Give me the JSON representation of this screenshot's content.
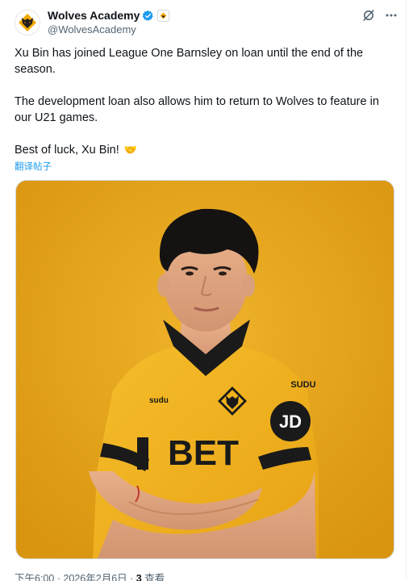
{
  "account": {
    "display_name": "Wolves Academy",
    "handle": "@WolvesAcademy",
    "avatar_icon": "wolf-head-icon",
    "verified_icon": "verified-badge-icon",
    "affiliate_icon": "club-affiliate-icon"
  },
  "actions": {
    "grok_icon": "grok-icon",
    "more_icon": "more-dots-icon"
  },
  "tweet": {
    "paragraph_1": "Xu Bin has joined League One Barnsley on loan until the end of the season.",
    "paragraph_2": "The development loan also allows him to return to Wolves to feature in our U21 games.",
    "paragraph_3": "Best of luck, Xu Bin!",
    "paragraph_3_emoji": "🤝",
    "translate_link": "翻译帖子"
  },
  "media": {
    "kind": "photo",
    "description_icon": "player-portrait",
    "shirt_sponsor": "BET",
    "sleeve_sponsor": "JD",
    "kit_brand": "SUDU",
    "background_color": "#e3a31a",
    "shirt_color": "#f2b11a"
  },
  "meta": {
    "time": "下午6:00",
    "separator": " · ",
    "date": "2026年2月6日",
    "views_count": "3",
    "views_label": " 查看"
  },
  "colors": {
    "link": "#1d9bf0",
    "secondary_text": "#536471",
    "primary_text": "#0f1419",
    "verified": "#1d9bf0"
  }
}
